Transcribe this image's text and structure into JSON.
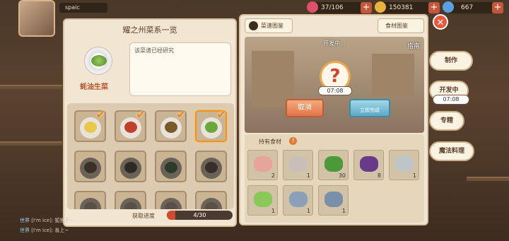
{
  "player": {
    "name": "spaic"
  },
  "resources": [
    {
      "icon": "heart-icon",
      "value": "37/106",
      "color": "#e0506a"
    },
    {
      "icon": "gold-coin-icon",
      "value": "150381",
      "color": "#e8b33a"
    },
    {
      "icon": "gem-icon",
      "value": "667",
      "color": "#5aa0e0"
    }
  ],
  "left_panel": {
    "title": "耀之州菜系一览",
    "dish_name": "蚝油生菜",
    "description": "该菜谱已经研究",
    "progress_label": "获取进度",
    "progress_text": "4/30",
    "progress_fraction": 0.133
  },
  "recipe_tiles": [
    {
      "food_color": "#e8c84a",
      "checked": true,
      "dim": false,
      "selected": false
    },
    {
      "food_color": "#c0402a",
      "checked": true,
      "dim": false,
      "selected": false
    },
    {
      "food_color": "#7a5a2a",
      "checked": true,
      "dim": false,
      "selected": false
    },
    {
      "food_color": "#6aa83a",
      "checked": true,
      "dim": false,
      "selected": true
    },
    {
      "food_color": "#3a3026",
      "checked": false,
      "dim": true,
      "selected": false
    },
    {
      "food_color": "#2e2a26",
      "checked": false,
      "dim": true,
      "selected": false
    },
    {
      "food_color": "#2e3a2a",
      "checked": false,
      "dim": true,
      "selected": false
    },
    {
      "food_color": "#3a2e2a",
      "checked": false,
      "dim": true,
      "selected": false
    },
    {
      "food_color": "#5a5048",
      "checked": false,
      "dim": true,
      "selected": false
    },
    {
      "food_color": "#5a5048",
      "checked": false,
      "dim": true,
      "selected": false
    },
    {
      "food_color": "#5a5048",
      "checked": false,
      "dim": true,
      "selected": false
    },
    {
      "food_color": "#5a5048",
      "checked": false,
      "dim": true,
      "selected": false
    }
  ],
  "chat": [
    {
      "channel": "世界",
      "text": "[I'm ice]: 狐狸子~"
    },
    {
      "channel": "世界",
      "text": "[I'm ice]: 善上~"
    }
  ],
  "right_panel": {
    "tab_recipes": "菜谱图鉴",
    "tab_ingredients": "食材图鉴",
    "scene_title": "开发中...",
    "question_mark": "?",
    "timer": "07:08",
    "guide_label": "指南",
    "cancel_label": "取消",
    "finish_line1": "立即完成",
    "held_title": "持有食材",
    "held_help": "?"
  },
  "ingredients": [
    {
      "name": "pork-belly",
      "color": "#e8a49a",
      "count": "2"
    },
    {
      "name": "fish-fillet",
      "color": "#c8c0b8",
      "count": "1"
    },
    {
      "name": "green-pepper",
      "color": "#4a9a3a",
      "count": "30"
    },
    {
      "name": "eggplant",
      "color": "#6a3a8a",
      "count": "8"
    },
    {
      "name": "oyster",
      "color": "#bfc4c8",
      "count": "1"
    },
    {
      "name": "lettuce",
      "color": "#8ac85a",
      "count": "1"
    },
    {
      "name": "shrimp",
      "color": "#8aa0b8",
      "count": "1"
    },
    {
      "name": "fish",
      "color": "#7890a8",
      "count": "1"
    }
  ],
  "side_menu": {
    "make": "制作",
    "developing": "开发中",
    "timer": "07:08",
    "expertise": "专精",
    "magic_cooking": "魔法料理"
  }
}
